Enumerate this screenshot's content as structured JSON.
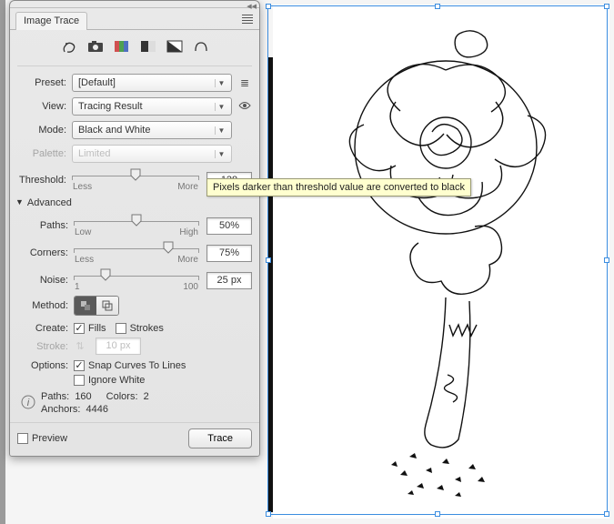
{
  "panel": {
    "title": "Image Trace",
    "preset_label": "Preset:",
    "preset_value": "[Default]",
    "view_label": "View:",
    "view_value": "Tracing Result",
    "mode_label": "Mode:",
    "mode_value": "Black and White",
    "palette_label": "Palette:",
    "palette_value": "Limited",
    "sliders": {
      "threshold": {
        "label": "Threshold:",
        "value": "128",
        "lo": "Less",
        "hi": "More",
        "pos": 50
      },
      "paths": {
        "label": "Paths:",
        "value": "50%",
        "lo": "Low",
        "hi": "High",
        "pos": 50
      },
      "corners": {
        "label": "Corners:",
        "value": "75%",
        "lo": "Less",
        "hi": "More",
        "pos": 75
      },
      "noise": {
        "label": "Noise:",
        "value": "25 px",
        "lo": "1",
        "hi": "100",
        "pos": 25
      }
    },
    "advanced_label": "Advanced",
    "method_label": "Method:",
    "create_label": "Create:",
    "fills_label": "Fills",
    "strokes_label": "Strokes",
    "stroke_label": "Stroke:",
    "stroke_value": "10 px",
    "options_label": "Options:",
    "snap_label": "Snap Curves To Lines",
    "ignore_label": "Ignore White",
    "stats": {
      "paths_label": "Paths:",
      "paths": "160",
      "colors_label": "Colors:",
      "colors": "2",
      "anchors_label": "Anchors:",
      "anchors": "4446"
    },
    "preview_label": "Preview",
    "trace_label": "Trace"
  },
  "tooltip": "Pixels darker than threshold value are converted to black"
}
